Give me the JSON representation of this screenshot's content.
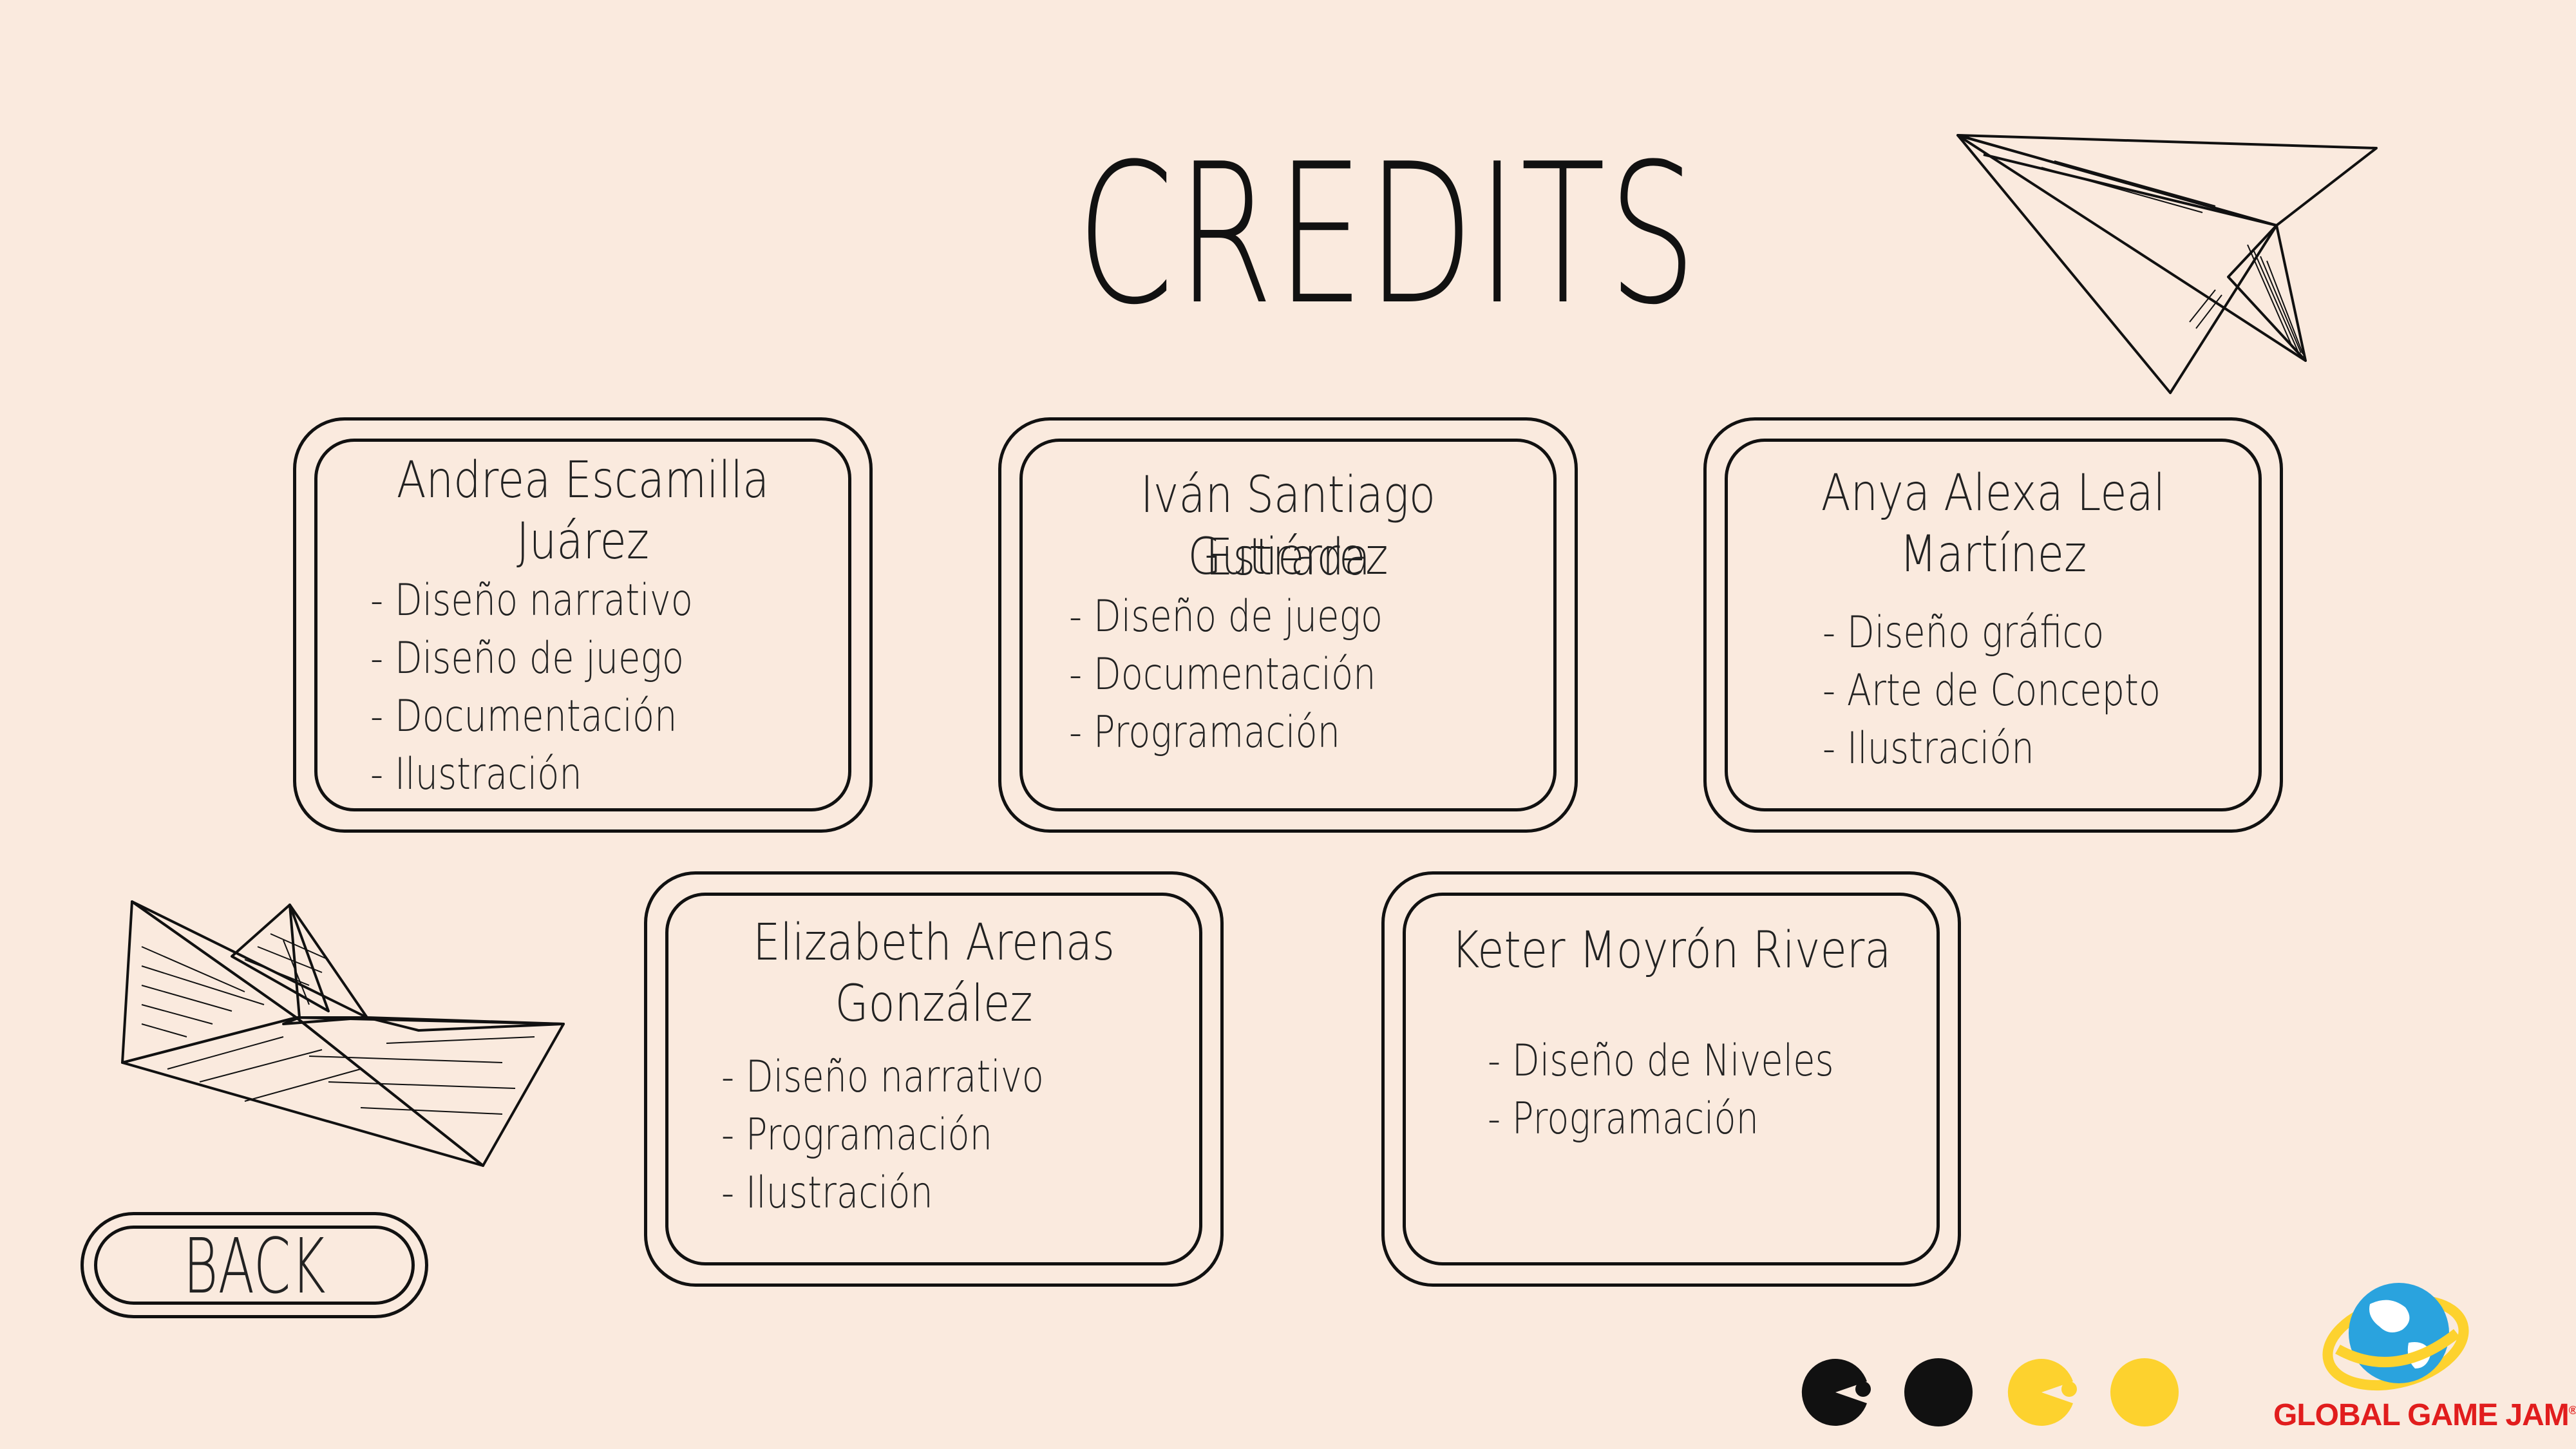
{
  "screen": {
    "title": "CREDITS",
    "back_label": "BACK"
  },
  "credits": [
    {
      "name_line1": "Andrea Escamilla",
      "name_line2": "Juárez",
      "roles": [
        "- Diseño narrativo",
        "- Diseño de juego",
        "- Documentación",
        "- Ilustración"
      ]
    },
    {
      "name_line1": "Iván Santiago Gutiérrez",
      "name_line2": "Estrada",
      "roles": [
        "- Diseño de juego",
        "- Documentación",
        "- Programación"
      ]
    },
    {
      "name_line1": "Anya Alexa Leal",
      "name_line2": "Martínez",
      "roles": [
        "- Diseño gráfico",
        "- Arte de Concepto",
        "- Ilustración"
      ]
    },
    {
      "name_line1": "Elizabeth Arenas",
      "name_line2": "González",
      "roles": [
        "- Diseño narrativo",
        "- Programación",
        "-  Ilustración"
      ]
    },
    {
      "name_line1": "Keter Moyrón Rivera",
      "name_line2": "",
      "roles": [
        "- Diseño de Niveles",
        "- Programación"
      ]
    }
  ],
  "logo": {
    "text": "GLOBAL GAME JAM",
    "mark": "®"
  },
  "colors": {
    "background": "#faeade",
    "ink": "#111111",
    "dot_yellow": "#fdd22e",
    "logo_red": "#e11d1d",
    "globe_blue": "#2aa3de"
  },
  "icons": [
    "paper-plane-icon",
    "paper-boat-icon",
    "dots-indicator",
    "global-game-jam-logo"
  ]
}
